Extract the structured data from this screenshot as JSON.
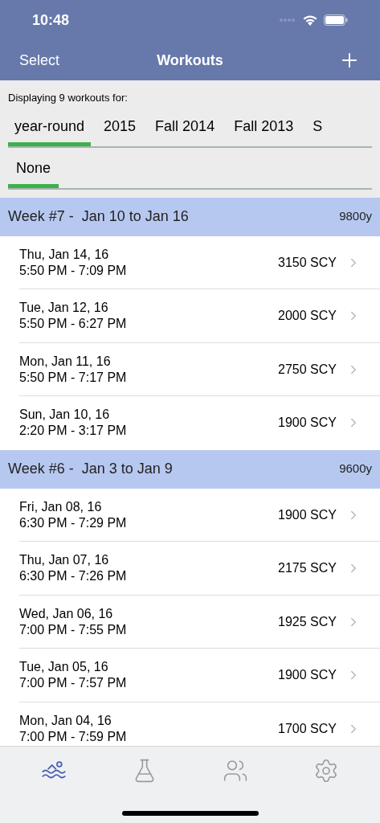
{
  "status_bar": {
    "time": "10:48"
  },
  "nav": {
    "left": "Select",
    "title": "Workouts"
  },
  "filter": {
    "caption": "Displaying 9 workouts for:",
    "seasons": [
      {
        "label": "year-round",
        "selected": true
      },
      {
        "label": "2015",
        "selected": false
      },
      {
        "label": "Fall 2014",
        "selected": false
      },
      {
        "label": "Fall 2013",
        "selected": false
      },
      {
        "label": "S",
        "selected": false
      }
    ],
    "groups": [
      {
        "label": "None",
        "selected": true
      }
    ]
  },
  "weeks": [
    {
      "title": "Week #7 -  Jan 10 to Jan 16",
      "total": "9800y",
      "workouts": [
        {
          "date": "Thu, Jan 14, 16",
          "time": "5:50 PM - 7:09 PM",
          "distance": "3150 SCY"
        },
        {
          "date": "Tue, Jan 12, 16",
          "time": "5:50 PM - 6:27 PM",
          "distance": "2000 SCY"
        },
        {
          "date": "Mon, Jan 11, 16",
          "time": "5:50 PM - 7:17 PM",
          "distance": "2750 SCY"
        },
        {
          "date": "Sun, Jan 10, 16",
          "time": "2:20 PM - 3:17 PM",
          "distance": "1900 SCY"
        }
      ]
    },
    {
      "title": "Week #6 -  Jan 3 to Jan 9",
      "total": "9600y",
      "workouts": [
        {
          "date": "Fri, Jan 08, 16",
          "time": "6:30 PM - 7:29 PM",
          "distance": "1900 SCY"
        },
        {
          "date": "Thu, Jan 07, 16",
          "time": "6:30 PM - 7:26 PM",
          "distance": "2175 SCY"
        },
        {
          "date": "Wed, Jan 06, 16",
          "time": "7:00 PM - 7:55 PM",
          "distance": "1925 SCY"
        },
        {
          "date": "Tue, Jan 05, 16",
          "time": "7:00 PM - 7:57 PM",
          "distance": "1900 SCY"
        },
        {
          "date": "Mon, Jan 04, 16",
          "time": "7:00 PM - 7:59 PM",
          "distance": "1700 SCY"
        }
      ]
    }
  ],
  "tab_bar": [
    {
      "kind": "swim",
      "selected": true
    },
    {
      "kind": "lab",
      "selected": false
    },
    {
      "kind": "people",
      "selected": false
    },
    {
      "kind": "settings",
      "selected": false
    }
  ]
}
